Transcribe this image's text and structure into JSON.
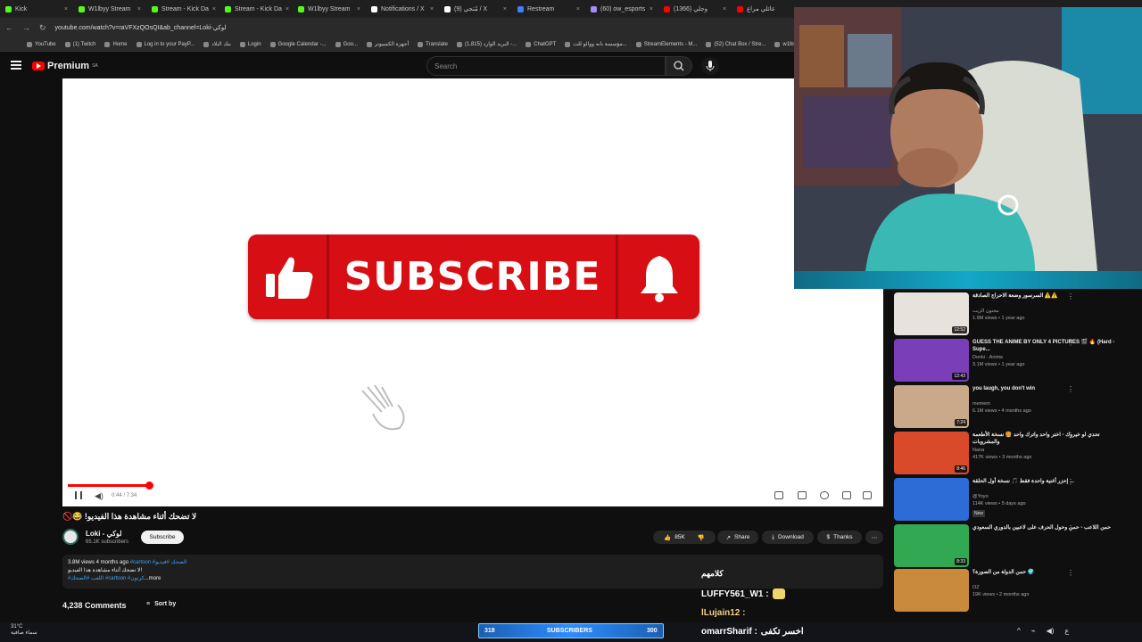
{
  "browser": {
    "tabs": [
      {
        "label": "Kick",
        "color": "#53fc18"
      },
      {
        "label": "W1lbyy Stream",
        "color": "#53fc18"
      },
      {
        "label": "Stream - Kick Da",
        "color": "#53fc18"
      },
      {
        "label": "Stream - Kick Da",
        "color": "#53fc18"
      },
      {
        "label": "W1lbyy Stream",
        "color": "#53fc18"
      },
      {
        "label": "Notifications / X",
        "color": "#ffffff"
      },
      {
        "label": "(9) مُتجي / X",
        "color": "#ffffff"
      },
      {
        "label": "Restream",
        "color": "#3b82f6"
      },
      {
        "label": "(60) ow_esports",
        "color": "#a78bfa"
      },
      {
        "label": "(1366) وجلي",
        "color": "#ff0000"
      },
      {
        "label": "عائلي مراع",
        "color": "#ff0000"
      }
    ],
    "url": "youtube.com/watch?v=raVFXzQOsQI&ab_channel=Loki-لوكي",
    "bookmarks": [
      "YouTube",
      "(1) Twitch",
      "Home",
      "Log in to your PayP...",
      "بنك البلاد",
      "Login",
      "Google Calendar -...",
      "Goo...",
      "أجهزة الكمبيوتر",
      "Translate",
      "(1,815) البريد الوارد -...",
      "ChatGPT",
      "مؤسسة بانه ووالو للت...",
      "StreamElements - M...",
      "(52) Chat Box / Stre...",
      "w1lbyy..."
    ]
  },
  "header": {
    "logo_text": "Premium",
    "logo_region": "SA",
    "search_placeholder": "Search"
  },
  "video": {
    "banner_text": "SUBSCRIBE",
    "time": "0:44 / 7:34",
    "progress_fraction": 0.1,
    "buffer_fraction": 0.18
  },
  "meta": {
    "title": "لا تضحك أثناء مشاهدة هذا الفيديو! 😂🚫",
    "channel_name": "Loki - لوكي",
    "channel_subs": "65.1K subscribers",
    "subscribe_label": "Subscribe",
    "likes": "85K",
    "share_label": "Share",
    "download_label": "Download",
    "thanks_label": "Thanks",
    "views_line": "3.8M views  4 months ago",
    "hashtags_line1": "#cartoon #الضحك #فيديو",
    "desc_line2": "لا تضحك أثناء مشاهدة هذا الفيديو!",
    "hashtags_line3": "#اللعب #الضحك #cartoon #كرتون",
    "more_label": "...more",
    "comments_count": "4,238 Comments",
    "sort_label": "Sort by"
  },
  "recommendations": [
    {
      "title": "السرسور وضعة الاحراج الصادقة ⚠️⚠️",
      "channel": "مجنون الزيت",
      "meta": "1.9M views • 1 year ago",
      "duration": "12:52",
      "color": "#e8e2dc"
    },
    {
      "title": "GUESS THE ANIME BY ONLY 4 PICTURES 🎬 🔥 (Hard - Supe...",
      "channel": "Donki - Anime",
      "meta": "3.1M views • 1 year ago",
      "duration": "12:43",
      "color": "#7a3fb8"
    },
    {
      "title": "you laugh, you don't win",
      "channel": "memem",
      "meta": "6.1M views • 4 months ago",
      "duration": "7:24",
      "color": "#caa98a"
    },
    {
      "title": "تحدي لو خيروك - اختر واحد واترك واحد 🍔 نسخة الأطعمة والمشروبات",
      "channel": "Nana",
      "meta": "417K views • 3 months ago",
      "duration": "8:46",
      "color": "#d94a2a"
    },
    {
      "title": "إحزر أغنية واحدة فقط 🎵 نسخة أول الحلقة ...",
      "channel": "@Yoyo",
      "meta": "114K views • 5 days ago",
      "duration": "",
      "badge": "New",
      "color": "#2d6bd6"
    },
    {
      "title": "حمن اللاعب - حمن وحول الحرف على لاعبين بالدوري السعودي",
      "channel": "",
      "meta": "",
      "duration": "8:33",
      "color": "#32a852"
    },
    {
      "title": "حمن الدولة من الصورة؟ 🌍",
      "channel": "OZ",
      "meta": "19K views • 2 months ago",
      "duration": "",
      "color": "#c98a3c"
    }
  ],
  "overlay": {
    "chat_header": "كلامهم",
    "chat_messages": [
      {
        "user": "LUFFY561_W1 :"
      },
      {
        "user": "lLujain12 :"
      },
      {
        "user": "omarrSharif :",
        "text": "اخسر تكفى"
      }
    ],
    "goal_left": "318",
    "goal_label": "SUBSCRIBERS",
    "goal_right": "300",
    "weather_temp": "31°C",
    "weather_desc": "سماء صافية"
  },
  "colors": {
    "yt_red": "#ff0000",
    "banner_red": "#d70e13",
    "link_blue": "#3ea6ff"
  }
}
